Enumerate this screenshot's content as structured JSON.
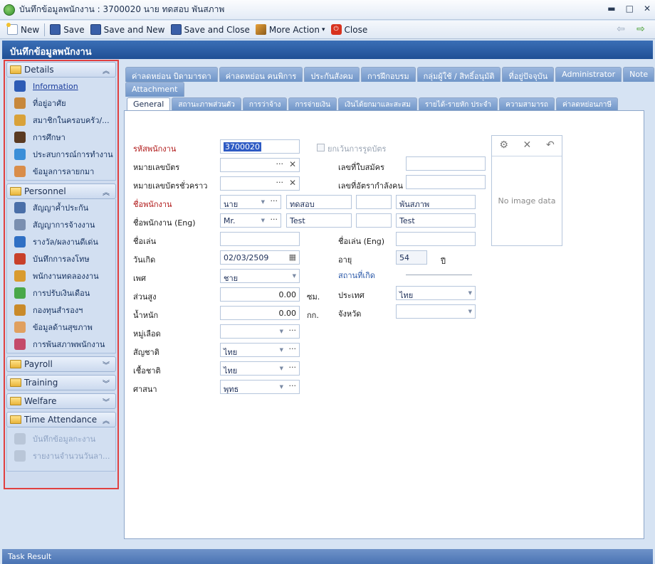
{
  "window": {
    "title": "บันทึกข้อมูลพนักงาน : 3700020 นาย ทดสอบ พันสภาพ",
    "min": "▬",
    "max": "□",
    "close": "✕"
  },
  "toolbar": {
    "new": "New",
    "save": "Save",
    "save_new": "Save and New",
    "save_close": "Save and Close",
    "more": "More Action",
    "close": "Close",
    "more_arrow": "▾",
    "back": "⇦",
    "forward": "⇨"
  },
  "header": {
    "title": "บันทึกข้อมูลพนักงาน"
  },
  "sidebar": {
    "details": {
      "label": "Details",
      "chevron": "︽",
      "items": [
        "Information",
        "ที่อยู่อาศัย",
        "สมาชิกในครอบครัว/...",
        "การศึกษา",
        "ประสบการณ์การทำงาน",
        "ข้อมูลการลายกมา"
      ]
    },
    "personnel": {
      "label": "Personnel",
      "chevron": "︽",
      "items": [
        "สัญญาค้ำประกัน",
        "สัญญาการจ้างงาน",
        "รางวัล/ผลงานดีเด่น",
        "บันทึกการลงโทษ",
        "พนักงานทดลองงาน",
        "การปรับเงินเดือน",
        "กองทุนสำรองฯ",
        "ข้อมูลด้านสุขภาพ",
        "การพ้นสภาพพนักงาน"
      ]
    },
    "payroll": {
      "label": "Payroll",
      "chevron": "︾"
    },
    "training": {
      "label": "Training",
      "chevron": "︾"
    },
    "welfare": {
      "label": "Welfare",
      "chevron": "︾"
    },
    "time": {
      "label": "Time Attendance",
      "chevron": "︽",
      "items": [
        "บันทึกข้อมูลกะงาน",
        "รายงานจำนวนวันลา..."
      ]
    }
  },
  "tabs1": [
    "ค่าลดหย่อน บิดามารดา",
    "ค่าลดหย่อน คนพิการ",
    "ประกันสังคม",
    "การฝึกอบรม",
    "กลุ่มผู้ใช้ / สิทธิ์อนุมัติ",
    "ที่อยู่ปัจจุบัน",
    "Administrator",
    "Note"
  ],
  "tab_attach": "Attachment",
  "tabs2": [
    "General",
    "สถานะภาพส่วนตัว",
    "การว่าจ้าง",
    "การจ่ายเงิน",
    "เงินได้ยกมาและสะสม",
    "รายได้-รายหัก ประจำ",
    "ความสามารถ",
    "ค่าลดหย่อนภาษี"
  ],
  "form": {
    "emp_code_label": "รหัสพนักงาน",
    "emp_code": "3700020",
    "exempt_label": "ยกเว้นการรูดบัตร",
    "card_label": "หมายเลขบัตร",
    "temp_card_label": "หมายเลขบัตรชั่วคราว",
    "app_no_label": "เลขที่ใบสมัคร",
    "manpower_label": "เลขที่อัตรากำลังคน",
    "name_label": "ชื่อพนักงาน",
    "title_th": "นาย",
    "first_th": "ทดสอบ",
    "last_th": "พันสภาพ",
    "name_en_label": "ชื่อพนักงาน (Eng)",
    "title_en": "Mr.",
    "first_en": "Test",
    "last_en": "Test",
    "nick_label": "ชื่อเล่น",
    "nick_en_label": "ชื่อเล่น (Eng)",
    "dob_label": "วันเกิด",
    "dob": "02/03/2509",
    "age_label": "อายุ",
    "age": "54",
    "age_unit": "ปี",
    "birthplace_label": "สถานที่เกิด",
    "gender_label": "เพศ",
    "gender": "ชาย",
    "height_label": "ส่วนสูง",
    "height": "0.00",
    "height_unit": "ซม.",
    "weight_label": "น้ำหนัก",
    "weight": "0.00",
    "weight_unit": "กก.",
    "country_label": "ประเทศ",
    "country": "ไทย",
    "province_label": "จังหวัด",
    "blood_label": "หมู่เลือด",
    "nationality_label": "สัญชาติ",
    "nationality": "ไทย",
    "race_label": "เชื้อชาติ",
    "race": "ไทย",
    "religion_label": "ศาสนา",
    "religion": "พุทธ",
    "no_image": "No image data"
  },
  "status": {
    "text": "Task Result"
  },
  "colors": {
    "header": "#1f4f95",
    "highlight_border": "#e04040",
    "required": "#b01818"
  }
}
